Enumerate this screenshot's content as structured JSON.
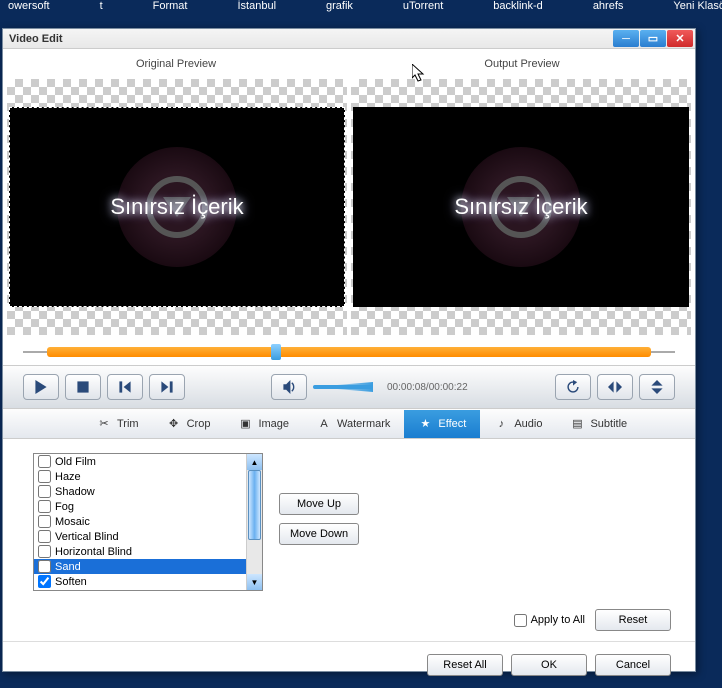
{
  "desktop": [
    "owersoft",
    "t",
    "Format",
    "İstanbul",
    "grafik",
    "uTorrent",
    "backlink-d",
    "ahrefs",
    "Yeni Klasö"
  ],
  "window": {
    "title": "Video Edit"
  },
  "previews": {
    "left_label": "Original Preview",
    "right_label": "Output Preview",
    "video_text": "Sınırsız İçerik"
  },
  "time": "00:00:08/00:00:22",
  "tabs": {
    "trim": "Trim",
    "crop": "Crop",
    "image": "Image",
    "watermark": "Watermark",
    "effect": "Effect",
    "audio": "Audio",
    "subtitle": "Subtitle"
  },
  "effects": [
    {
      "label": "Old Film",
      "checked": false,
      "selected": false
    },
    {
      "label": "Haze",
      "checked": false,
      "selected": false
    },
    {
      "label": "Shadow",
      "checked": false,
      "selected": false
    },
    {
      "label": "Fog",
      "checked": false,
      "selected": false
    },
    {
      "label": "Mosaic",
      "checked": false,
      "selected": false
    },
    {
      "label": "Vertical Blind",
      "checked": false,
      "selected": false
    },
    {
      "label": "Horizontal Blind",
      "checked": false,
      "selected": false
    },
    {
      "label": "Sand",
      "checked": false,
      "selected": true
    },
    {
      "label": "Soften",
      "checked": true,
      "selected": false
    }
  ],
  "buttons": {
    "move_up": "Move Up",
    "move_down": "Move Down",
    "apply_all": "Apply to All",
    "reset": "Reset",
    "reset_all": "Reset All",
    "ok": "OK",
    "cancel": "Cancel"
  }
}
